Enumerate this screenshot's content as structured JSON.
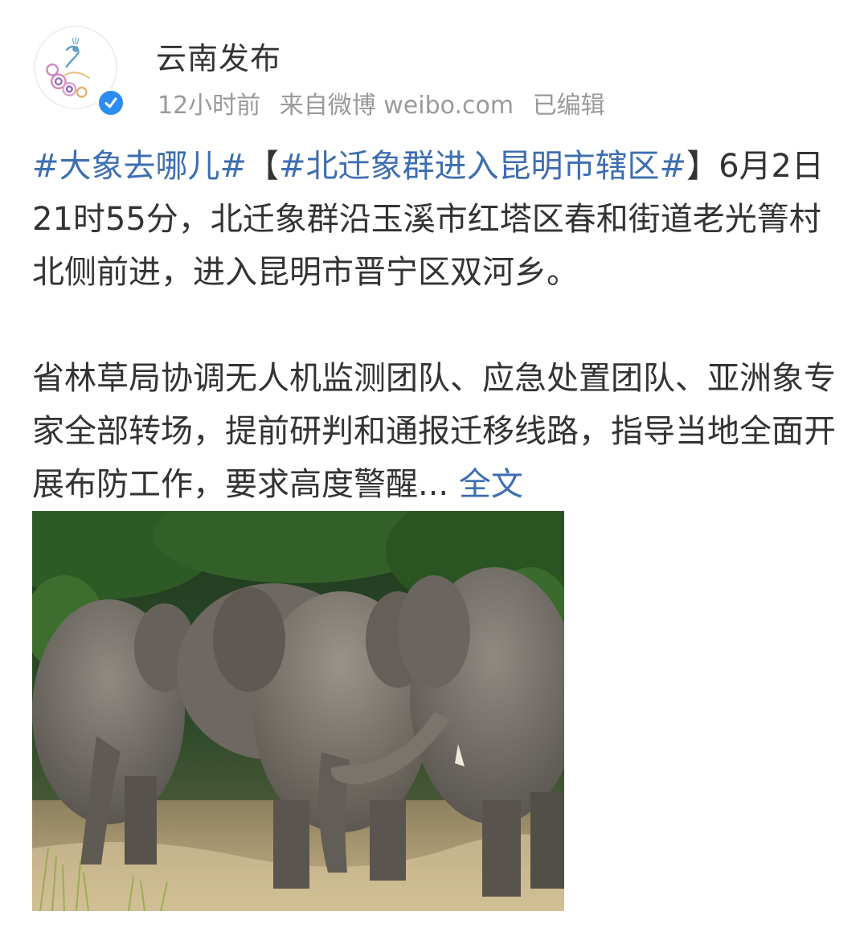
{
  "account": {
    "name": "云南发布",
    "avatar_text": "云南发布",
    "time": "12小时前",
    "source": "来自微博 weibo.com",
    "edited": "已编辑"
  },
  "post": {
    "tag1": "#大象去哪儿#",
    "bracket_open": "【",
    "tag2": "#北迁象群进入昆明市辖区#",
    "bracket_close": "】",
    "para1_text": "6月2日21时55分，北迁象群沿玉溪市红塔区春和街道老光箐村北侧前进，进入昆明市晋宁区双河乡。",
    "para2_text": "省林草局协调无人机监测团队、应急处置团队、亚洲象专家全部转场，提前研判和通报迁移线路，指导当地全面开展布防工作，要求高度警醒...",
    "more_link": "全文"
  },
  "colors": {
    "link": "#3d6eb0",
    "meta": "#9a9a9a",
    "verified": "#2d8cf0"
  },
  "icons": {
    "avatar": "peacock-logo-icon",
    "verified": "verified-badge-icon"
  }
}
